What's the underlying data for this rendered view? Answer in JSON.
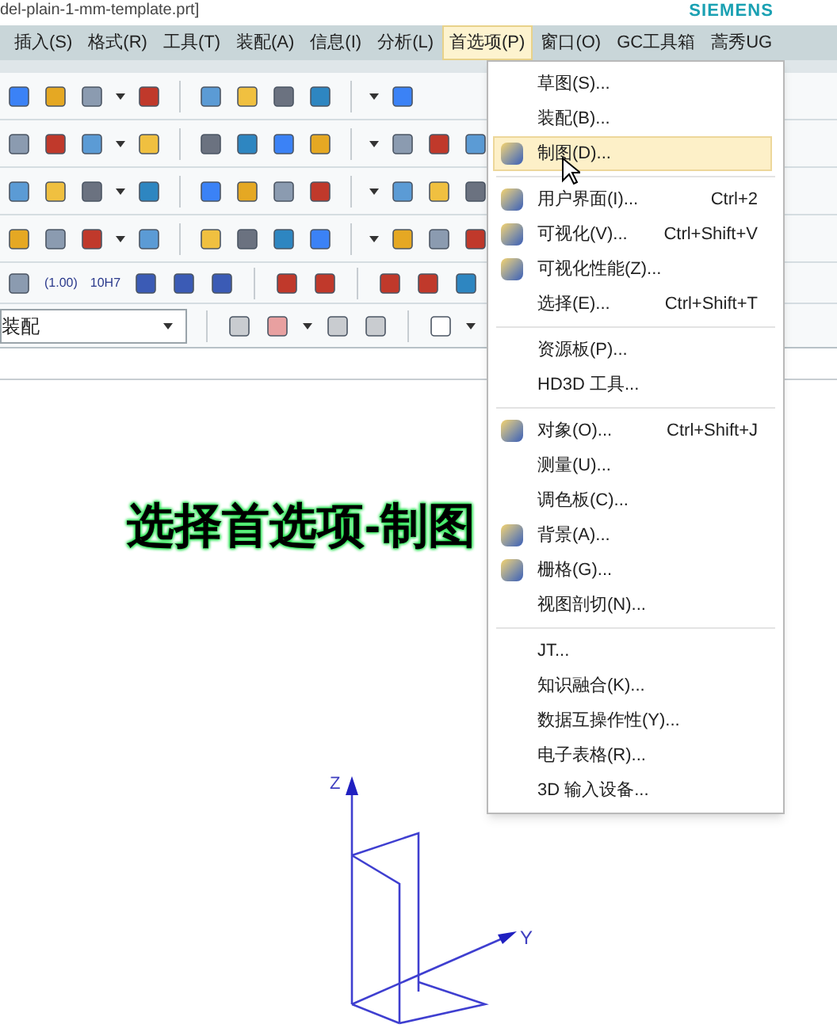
{
  "window": {
    "title": "del-plain-1-mm-template.prt]",
    "brand": "SIEMENS"
  },
  "menubar": [
    {
      "label": "插入(S)",
      "selected": false
    },
    {
      "label": "格式(R)",
      "selected": false
    },
    {
      "label": "工具(T)",
      "selected": false
    },
    {
      "label": "装配(A)",
      "selected": false
    },
    {
      "label": "信息(I)",
      "selected": false
    },
    {
      "label": "分析(L)",
      "selected": false
    },
    {
      "label": "首选项(P)",
      "selected": true
    },
    {
      "label": "窗口(O)",
      "selected": false
    },
    {
      "label": "GC工具箱",
      "selected": false
    },
    {
      "label": "蒿秀UG",
      "selected": false
    }
  ],
  "toolbar": {
    "tolerance_texts": [
      "(1.00)",
      "10H7"
    ],
    "filter_dropdown": {
      "value": "装配"
    }
  },
  "caption": "选择首选项-制图",
  "axes": {
    "z_label": "Z",
    "y_label": "Y"
  },
  "menu": {
    "groups": [
      [
        {
          "label": "草图(S)...",
          "icon": false,
          "selected": false
        },
        {
          "label": "装配(B)...",
          "icon": false,
          "selected": false
        },
        {
          "label": "制图(D)...",
          "icon": true,
          "selected": true
        }
      ],
      [
        {
          "label": "用户界面(I)...",
          "shortcut": "Ctrl+2",
          "icon": true,
          "selected": false
        },
        {
          "label": "可视化(V)...",
          "shortcut": "Ctrl+Shift+V",
          "icon": true,
          "selected": false
        },
        {
          "label": "可视化性能(Z)...",
          "icon": true,
          "selected": false
        },
        {
          "label": "选择(E)...",
          "shortcut": "Ctrl+Shift+T",
          "icon": false,
          "selected": false
        }
      ],
      [
        {
          "label": "资源板(P)...",
          "icon": false,
          "selected": false
        },
        {
          "label": "HD3D 工具...",
          "icon": false,
          "selected": false
        }
      ],
      [
        {
          "label": "对象(O)...",
          "shortcut": "Ctrl+Shift+J",
          "icon": true,
          "selected": false
        },
        {
          "label": "测量(U)...",
          "icon": false,
          "selected": false
        },
        {
          "label": "调色板(C)...",
          "icon": false,
          "selected": false
        },
        {
          "label": "背景(A)...",
          "icon": true,
          "selected": false
        },
        {
          "label": "栅格(G)...",
          "icon": true,
          "selected": false
        },
        {
          "label": "视图剖切(N)...",
          "icon": false,
          "selected": false
        }
      ],
      [
        {
          "label": "JT...",
          "icon": false,
          "selected": false
        },
        {
          "label": "知识融合(K)...",
          "icon": false,
          "selected": false
        },
        {
          "label": "数据互操作性(Y)...",
          "icon": false,
          "selected": false
        },
        {
          "label": "电子表格(R)...",
          "icon": false,
          "selected": false
        },
        {
          "label": "3D 输入设备...",
          "icon": false,
          "selected": false
        }
      ]
    ]
  }
}
